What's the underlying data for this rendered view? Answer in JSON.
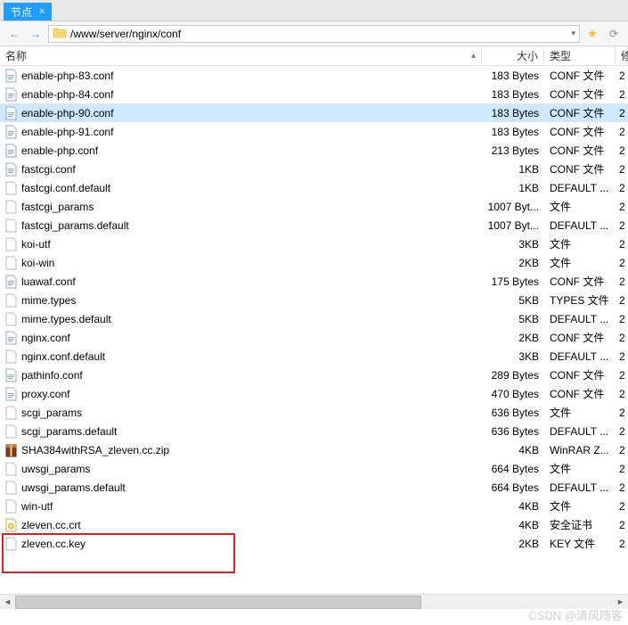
{
  "tab": {
    "label": "节点",
    "close": "×"
  },
  "nav": {
    "back": "←",
    "fwd": "→",
    "path": "/www/server/nginx/conf",
    "dropdown": "▾",
    "star": "★",
    "refresh": "⟳"
  },
  "headers": {
    "name": "名称",
    "size": "大小",
    "type": "类型",
    "date": "修",
    "sort": "▴"
  },
  "files": [
    {
      "name": "enable-php-83.conf",
      "size": "183 Bytes",
      "type": "CONF 文件",
      "date": "2",
      "icon": "conf"
    },
    {
      "name": "enable-php-84.conf",
      "size": "183 Bytes",
      "type": "CONF 文件",
      "date": "2",
      "icon": "conf"
    },
    {
      "name": "enable-php-90.conf",
      "size": "183 Bytes",
      "type": "CONF 文件",
      "date": "2",
      "icon": "conf",
      "selected": true
    },
    {
      "name": "enable-php-91.conf",
      "size": "183 Bytes",
      "type": "CONF 文件",
      "date": "2",
      "icon": "conf"
    },
    {
      "name": "enable-php.conf",
      "size": "213 Bytes",
      "type": "CONF 文件",
      "date": "2",
      "icon": "conf"
    },
    {
      "name": "fastcgi.conf",
      "size": "1KB",
      "type": "CONF 文件",
      "date": "2",
      "icon": "conf"
    },
    {
      "name": "fastcgi.conf.default",
      "size": "1KB",
      "type": "DEFAULT ...",
      "date": "2",
      "icon": "file"
    },
    {
      "name": "fastcgi_params",
      "size": "1007 Byt...",
      "type": "文件",
      "date": "2",
      "icon": "file"
    },
    {
      "name": "fastcgi_params.default",
      "size": "1007 Byt...",
      "type": "DEFAULT ...",
      "date": "2",
      "icon": "file"
    },
    {
      "name": "koi-utf",
      "size": "3KB",
      "type": "文件",
      "date": "2",
      "icon": "file"
    },
    {
      "name": "koi-win",
      "size": "2KB",
      "type": "文件",
      "date": "2",
      "icon": "file"
    },
    {
      "name": "luawaf.conf",
      "size": "175 Bytes",
      "type": "CONF 文件",
      "date": "2",
      "icon": "conf"
    },
    {
      "name": "mime.types",
      "size": "5KB",
      "type": "TYPES 文件",
      "date": "2",
      "icon": "file"
    },
    {
      "name": "mime.types.default",
      "size": "5KB",
      "type": "DEFAULT ...",
      "date": "2",
      "icon": "file"
    },
    {
      "name": "nginx.conf",
      "size": "2KB",
      "type": "CONF 文件",
      "date": "2",
      "icon": "conf"
    },
    {
      "name": "nginx.conf.default",
      "size": "3KB",
      "type": "DEFAULT ...",
      "date": "2",
      "icon": "file"
    },
    {
      "name": "pathinfo.conf",
      "size": "289 Bytes",
      "type": "CONF 文件",
      "date": "2",
      "icon": "conf"
    },
    {
      "name": "proxy.conf",
      "size": "470 Bytes",
      "type": "CONF 文件",
      "date": "2",
      "icon": "conf"
    },
    {
      "name": "scgi_params",
      "size": "636 Bytes",
      "type": "文件",
      "date": "2",
      "icon": "file"
    },
    {
      "name": "scgi_params.default",
      "size": "636 Bytes",
      "type": "DEFAULT ...",
      "date": "2",
      "icon": "file"
    },
    {
      "name": "SHA384withRSA_zleven.cc.zip",
      "size": "4KB",
      "type": "WinRAR Z...",
      "date": "2",
      "icon": "zip"
    },
    {
      "name": "uwsgi_params",
      "size": "664 Bytes",
      "type": "文件",
      "date": "2",
      "icon": "file"
    },
    {
      "name": "uwsgi_params.default",
      "size": "664 Bytes",
      "type": "DEFAULT ...",
      "date": "2",
      "icon": "file"
    },
    {
      "name": "win-utf",
      "size": "4KB",
      "type": "文件",
      "date": "2",
      "icon": "file"
    },
    {
      "name": "zleven.cc.crt",
      "size": "4KB",
      "type": "安全证书",
      "date": "2",
      "icon": "cert"
    },
    {
      "name": "zleven.cc.key",
      "size": "2KB",
      "type": "KEY 文件",
      "date": "2",
      "icon": "file"
    }
  ],
  "watermark": "CSDN @清风随客"
}
